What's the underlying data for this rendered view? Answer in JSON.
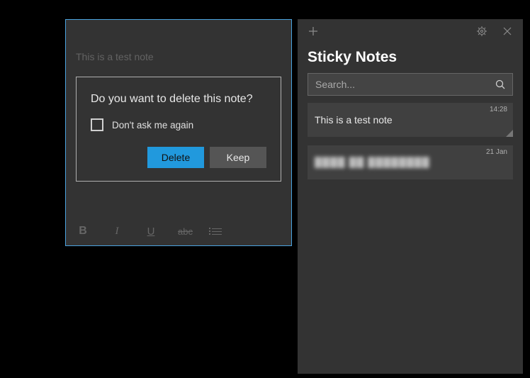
{
  "note_editor": {
    "content": "This is a test note",
    "toolbar": {
      "bold": "B",
      "italic": "I",
      "underline": "U",
      "strike": "abc"
    }
  },
  "dialog": {
    "message": "Do you want to delete this note?",
    "checkbox_label": "Don't ask me again",
    "delete_label": "Delete",
    "keep_label": "Keep"
  },
  "list_panel": {
    "title": "Sticky Notes",
    "search_placeholder": "Search...",
    "notes": [
      {
        "preview": "This is a test note",
        "timestamp": "14:28",
        "has_corner": true
      },
      {
        "preview": "████ ██ ████████",
        "timestamp": "21 Jan",
        "has_corner": false,
        "blurred": true
      }
    ]
  }
}
